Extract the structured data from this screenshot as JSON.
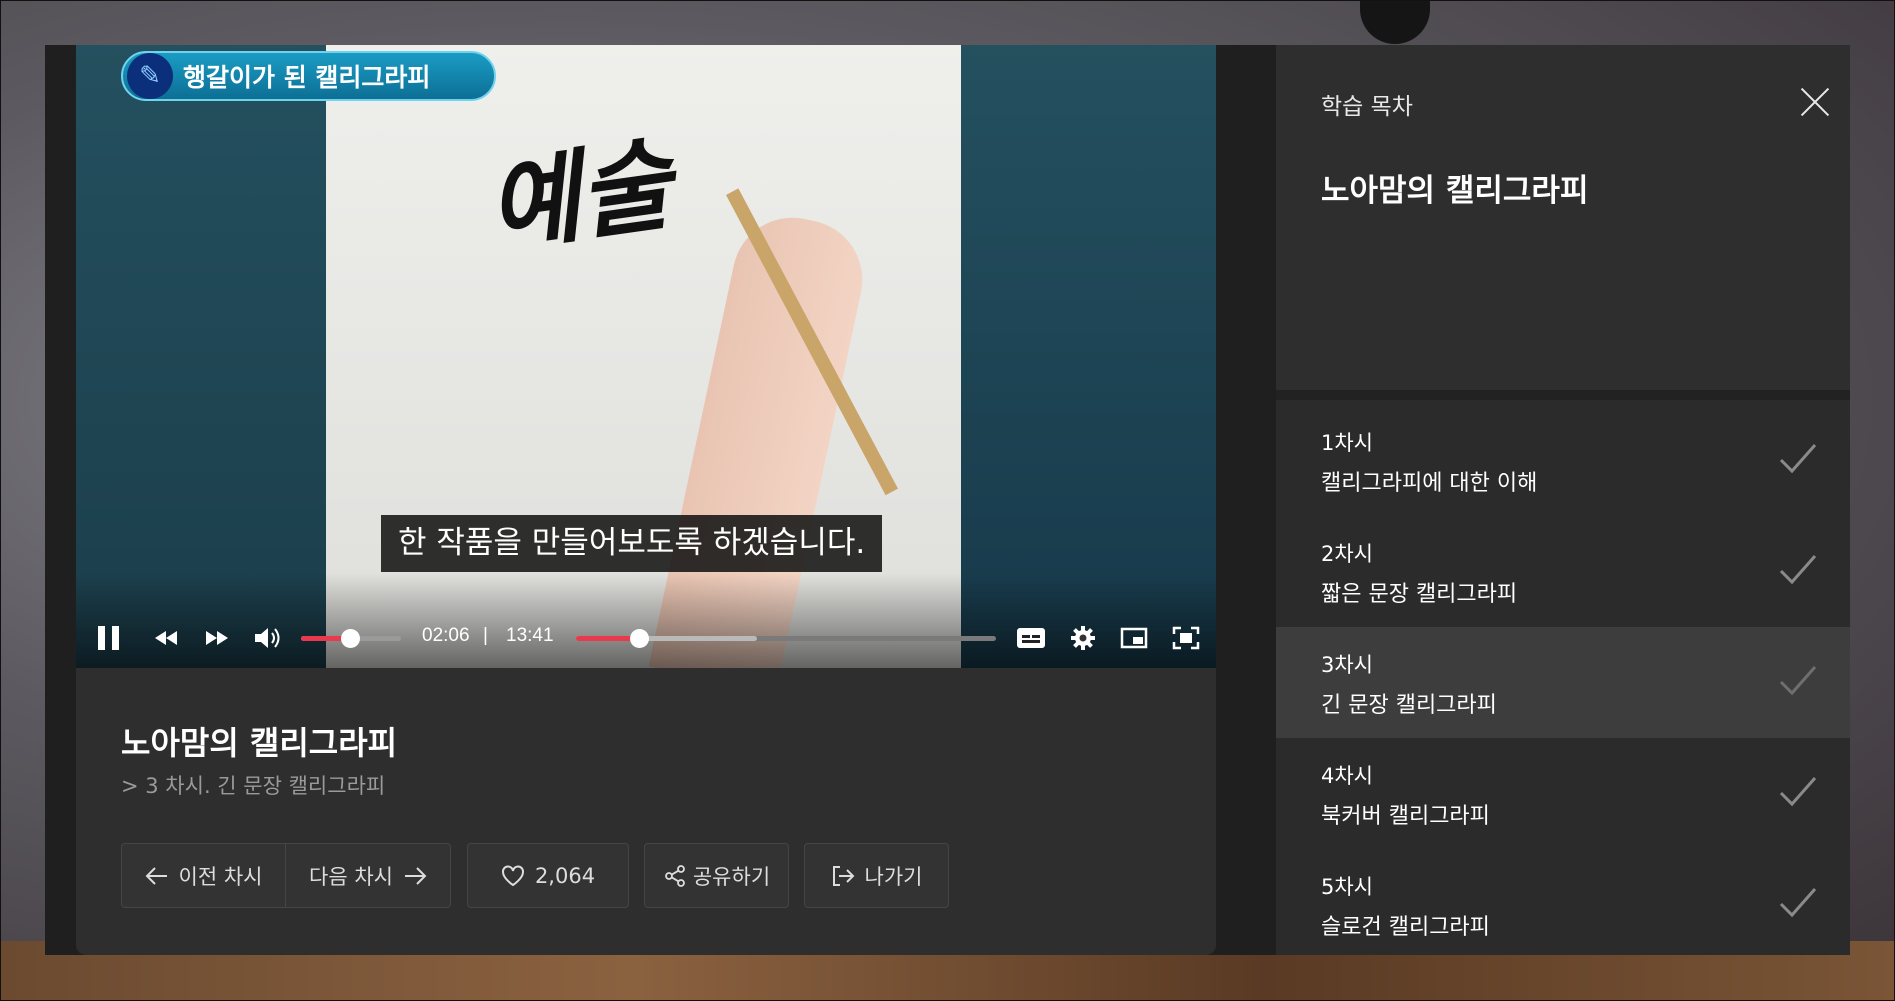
{
  "video": {
    "banner_text": "행갈이가 된 캘리그라피",
    "calligraphy_text": "예술",
    "subtitle": "한 작품을 만들어보도록 하겠습니다.",
    "current_time": "02:06",
    "time_separator": "|",
    "duration": "13:41",
    "volume_level": 0.5,
    "progress_fraction": 0.1535,
    "buffered_fraction": 0.43,
    "accent_color": "#e8394d"
  },
  "info": {
    "course_title": "노아맘의 캘리그라피",
    "lesson_path": "> 3 차시. 긴 문장 캘리그라피",
    "prev_label": "이전 차시",
    "next_label": "다음 차시",
    "like_count": "2,064",
    "share_label": "공유하기",
    "exit_label": "나가기"
  },
  "sidebar": {
    "label": "학습 목차",
    "course_title": "노아맘의 캘리그라피",
    "lessons": [
      {
        "no": "1차시",
        "name": "캘리그라피에 대한 이해",
        "completed": true
      },
      {
        "no": "2차시",
        "name": "짧은 문장 캘리그라피",
        "completed": true
      },
      {
        "no": "3차시",
        "name": "긴 문장 캘리그라피",
        "completed": true,
        "active": true
      },
      {
        "no": "4차시",
        "name": "북커버 캘리그라피",
        "completed": true
      },
      {
        "no": "5차시",
        "name": "슬로건 캘리그라피",
        "completed": true
      }
    ]
  }
}
